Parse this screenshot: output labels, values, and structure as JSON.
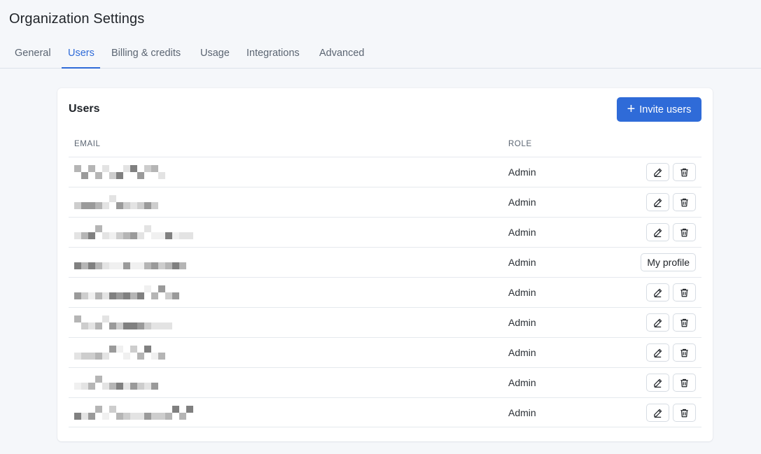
{
  "page": {
    "title": "Organization Settings"
  },
  "tabs": [
    {
      "label": "General",
      "active": false
    },
    {
      "label": "Users",
      "active": true
    },
    {
      "label": "Billing & credits",
      "active": false
    },
    {
      "label": "Usage",
      "active": false
    },
    {
      "label": "Integrations",
      "active": false
    },
    {
      "label": "Advanced",
      "active": false
    }
  ],
  "users_card": {
    "title": "Users",
    "invite_button": {
      "label": "Invite users",
      "icon": "plus-icon"
    },
    "columns": {
      "email": "EMAIL",
      "role": "ROLE"
    },
    "rows": [
      {
        "email": "",
        "email_redacted": true,
        "role": "Admin",
        "actions": [
          "edit-icon",
          "trash-icon"
        ]
      },
      {
        "email": "",
        "email_redacted": true,
        "role": "Admin",
        "actions": [
          "edit-icon",
          "trash-icon"
        ]
      },
      {
        "email": "",
        "email_redacted": true,
        "role": "Admin",
        "actions": [
          "edit-icon",
          "trash-icon"
        ]
      },
      {
        "email": "",
        "email_redacted": true,
        "role": "Admin",
        "actions": [
          "my-profile"
        ],
        "profile_label": "My profile"
      },
      {
        "email": "",
        "email_redacted": true,
        "role": "Admin",
        "actions": [
          "edit-icon",
          "trash-icon"
        ]
      },
      {
        "email": "",
        "email_redacted": true,
        "role": "Admin",
        "actions": [
          "edit-icon",
          "trash-icon"
        ]
      },
      {
        "email": "",
        "email_redacted": true,
        "role": "Admin",
        "actions": [
          "edit-icon",
          "trash-icon"
        ]
      },
      {
        "email": "",
        "email_redacted": true,
        "role": "Admin",
        "actions": [
          "edit-icon",
          "trash-icon"
        ]
      },
      {
        "email": "",
        "email_redacted": true,
        "role": "Admin",
        "actions": [
          "edit-icon",
          "trash-icon"
        ]
      }
    ]
  },
  "colors": {
    "accent": "#2f6bd8",
    "background": "#f5f7fa",
    "card": "#ffffff",
    "border": "#e5e9ee"
  }
}
